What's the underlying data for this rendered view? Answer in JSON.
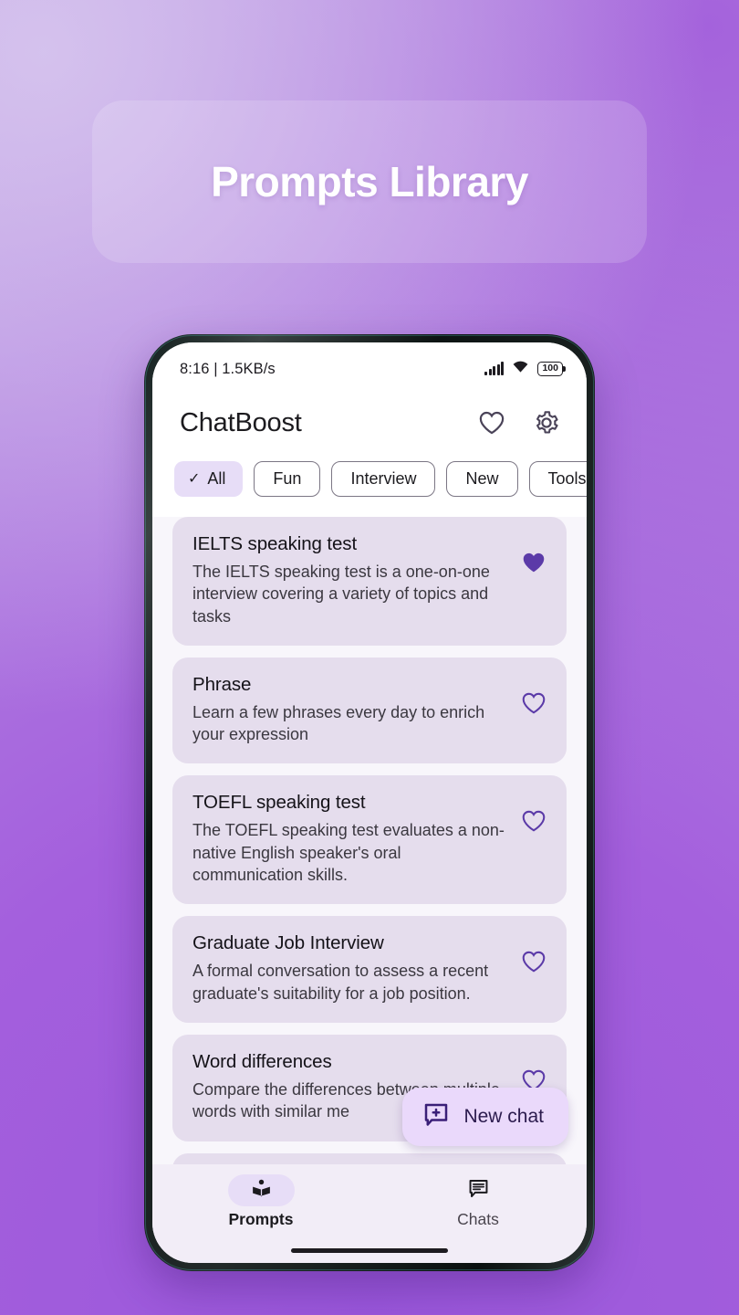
{
  "banner": {
    "title": "Prompts Library"
  },
  "statusbar": {
    "time_and_speed": "8:16 | 1.5KB/s",
    "signal_icon": "signal-bars-icon",
    "wifi_icon": "wifi-icon",
    "battery_level": "100"
  },
  "appbar": {
    "title": "ChatBoost",
    "favorites_icon": "heart-outline-icon",
    "settings_icon": "gear-icon"
  },
  "filters": {
    "selected": "All",
    "chips": [
      {
        "label": "All",
        "selected": true
      },
      {
        "label": "Fun",
        "selected": false
      },
      {
        "label": "Interview",
        "selected": false
      },
      {
        "label": "New",
        "selected": false
      },
      {
        "label": "Tools",
        "selected": false
      }
    ]
  },
  "prompts": [
    {
      "title": "IELTS speaking test",
      "description": "The IELTS speaking test is a one-on-one interview covering a variety of topics and tasks",
      "favorited": true
    },
    {
      "title": "Phrase",
      "description": "Learn a few phrases every day to enrich your expression",
      "favorited": false
    },
    {
      "title": "TOEFL speaking test",
      "description": "The TOEFL speaking test evaluates a non-native English speaker's oral communication skills.",
      "favorited": false
    },
    {
      "title": "Graduate Job Interview",
      "description": "A formal conversation to assess a recent graduate's suitability for a job position.",
      "favorited": false
    },
    {
      "title": "Word differences",
      "description": "Compare the differences between multiple words with similar me",
      "favorited": false
    }
  ],
  "fab": {
    "label": "New chat",
    "icon": "chat-bubble-plus-icon"
  },
  "bottom_nav": {
    "items": [
      {
        "label": "Prompts",
        "icon": "book-library-icon",
        "active": true
      },
      {
        "label": "Chats",
        "icon": "chat-message-icon",
        "active": false
      }
    ]
  },
  "colors": {
    "accent": "#5b3aa8",
    "chip_selected_bg": "#e7ddf7",
    "card_bg": "#e5dded",
    "page_bg": "#f8f6fb",
    "fab_bg": "#ead9fb",
    "bg_gradient_light": "#c0a3e4",
    "bg_gradient_dark": "#9a57db"
  }
}
